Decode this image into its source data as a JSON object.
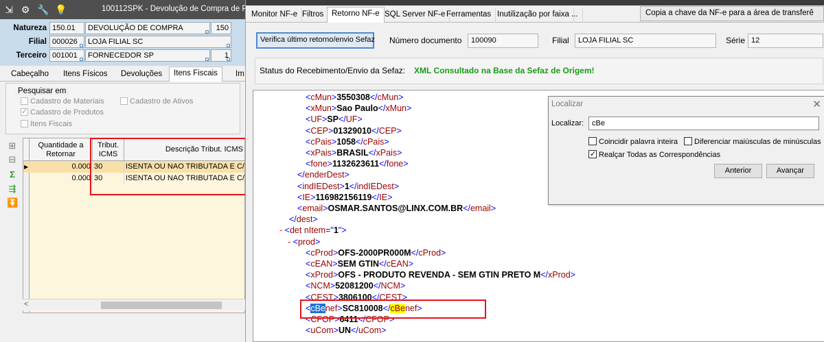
{
  "left_window": {
    "title": "100112SPK - Devolução de Compra de Produ",
    "toolbar_icons": [
      "export-icon",
      "gear-icon",
      "wrench-icon",
      "lightbulb-icon"
    ],
    "fields": {
      "natureza_label": "Natureza",
      "natureza_code": "150.01",
      "natureza_desc": "DEVOLUÇÃO DE COMPRA",
      "natureza_num": "150",
      "filial_label": "Filial",
      "filial_code": "000026",
      "filial_desc": "LOJA FILIAL SC",
      "terceiro_label": "Terceiro",
      "terceiro_code": "001001",
      "terceiro_desc": "FORNECEDOR SP",
      "terceiro_num": "1"
    },
    "tabs": [
      "Cabeçalho",
      "Itens Físicos",
      "Devoluções",
      "Itens Fiscais",
      "Im"
    ],
    "active_tab": "Itens Fiscais",
    "search": {
      "legend": "Pesquisar em",
      "options": [
        {
          "label": "Cadastro de Materiais",
          "checked": false
        },
        {
          "label": "Cadastro de Ativos",
          "checked": false
        },
        {
          "label": "Cadastro de Produtos",
          "checked": true
        },
        {
          "label": "Itens Fiscais",
          "checked": false
        }
      ]
    },
    "grid": {
      "columns": [
        "Quantidade a Retornar",
        "Tribut. ICMS",
        "Descrição Tribut. ICMS"
      ],
      "rows": [
        {
          "quantidade": "0.000",
          "tribut": "30",
          "descricao": "ISENTA OU NAO TRIBUTADA E C/CO"
        },
        {
          "quantidade": "0.000",
          "tribut": "30",
          "descricao": "ISENTA OU NAO TRIBUTADA E C/CO"
        }
      ]
    }
  },
  "right_window": {
    "tabs": [
      "Monitor NF-e",
      "Filtros",
      "Retorno NF-e",
      "SQL Server NF-e",
      "Ferramentas",
      "Inutilização por faixa",
      "..."
    ],
    "active_tab": "Retorno NF-e",
    "copy_button": "Copia a chave da NF-e para a área de transferê",
    "verify_button": "Verifica último retorno/envio Sefaz",
    "numero_label": "Número documento",
    "numero_value": "100090",
    "filial_label": "Filial",
    "filial_value": "LOJA FILIAL SC",
    "serie_label": "Série",
    "serie_value": "12",
    "status_label": "Status do Recebimento/Envio da Sefaz:",
    "status_value": "XML Consultado na Base da Sefaz de Origem!",
    "xml_lines": [
      {
        "tag": "cMun",
        "value": "3550308"
      },
      {
        "tag": "xMun",
        "value": "Sao Paulo"
      },
      {
        "tag": "UF",
        "value": "SP"
      },
      {
        "tag": "CEP",
        "value": "01329010"
      },
      {
        "tag": "cPais",
        "value": "1058"
      },
      {
        "tag": "xPais",
        "value": "BRASIL"
      },
      {
        "tag": "fone",
        "value": "1132623611"
      },
      {
        "close": "enderDest"
      },
      {
        "tag": "indIEDest",
        "value": "1"
      },
      {
        "tag": "IE",
        "value": "116982156119"
      },
      {
        "tag": "email",
        "value": "OSMAR.SANTOS@LINX.COM.BR"
      },
      {
        "close": "dest"
      },
      {
        "open": "det",
        "attr_name": "nItem",
        "attr_value": "1"
      },
      {
        "open": "prod"
      },
      {
        "tag": "cProd",
        "value": "OFS-2000PR000M"
      },
      {
        "tag": "cEAN",
        "value": "SEM GTIN"
      },
      {
        "tag": "xProd",
        "value": "OFS - PRODUTO REVENDA - SEM GTIN PRETO M"
      },
      {
        "tag": "NCM",
        "value": "52081200"
      },
      {
        "tag": "CEST",
        "value": "3806100"
      },
      {
        "tag": "cBenef",
        "value": "SC810008"
      },
      {
        "tag": "CFOP",
        "value": "6411"
      },
      {
        "tag": "uCom",
        "value": "UN"
      }
    ],
    "find_dialog": {
      "title": "Localizar",
      "label": "Localizar:",
      "value": "cBe",
      "options": [
        {
          "label": "Coincidir palavra inteira",
          "checked": false
        },
        {
          "label": "Diferenciar maiúsculas de minúsculas",
          "checked": false
        },
        {
          "label": "Realçar Todas as Correspondências",
          "checked": true
        }
      ],
      "prev_button": "Anterior",
      "next_button": "Avançar"
    }
  }
}
